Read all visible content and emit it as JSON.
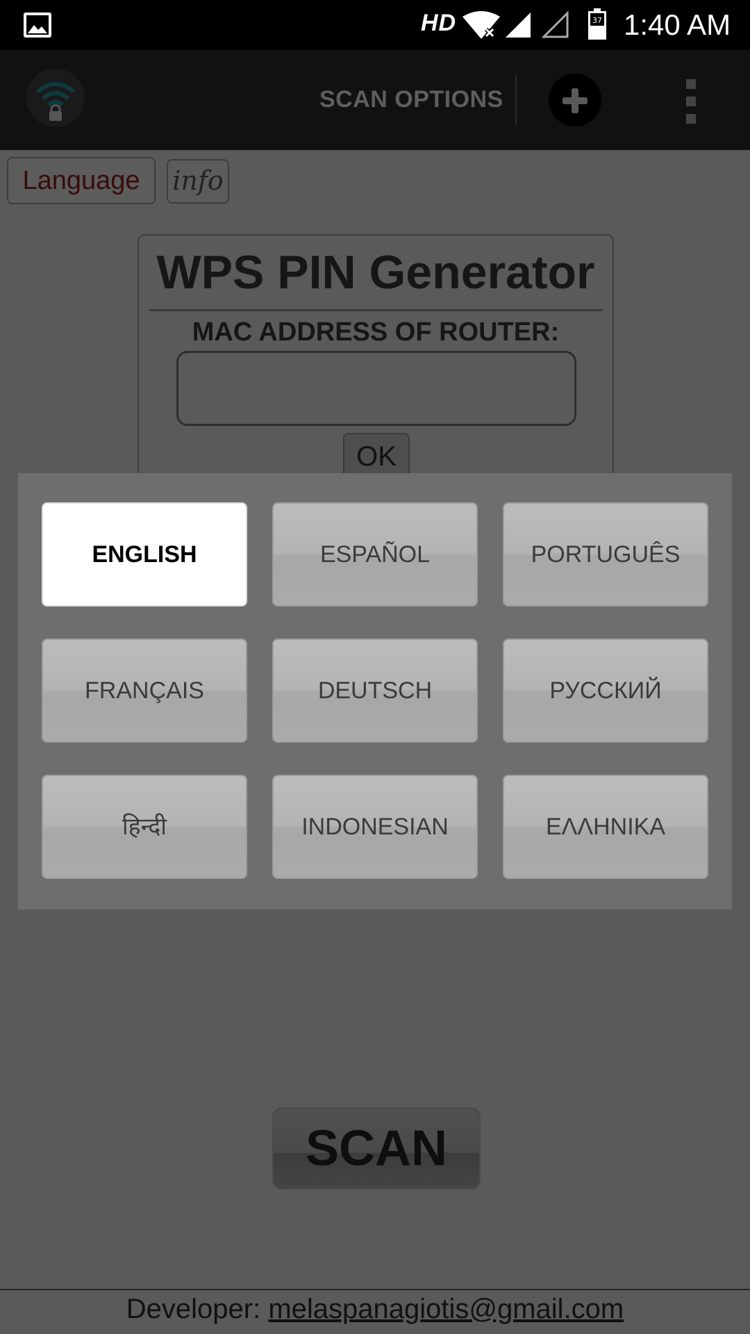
{
  "status_bar": {
    "network": "HD",
    "battery": "37",
    "time": "1:40 AM"
  },
  "action_bar": {
    "scan_options_label": "SCAN OPTIONS"
  },
  "top_buttons": {
    "language_label": "Language",
    "info_label": "info"
  },
  "card": {
    "title": "WPS PIN Generator",
    "mac_label": "MAC ADDRESS OF ROUTER:",
    "mac_value": "",
    "ok_label": "OK"
  },
  "language_dialog": {
    "selected": "ENGLISH",
    "options": [
      "ENGLISH",
      "ESPAÑOL",
      "PORTUGUÊS",
      "FRANÇAIS",
      "DEUTSCH",
      "РУССКИЙ",
      "हिन्दी",
      "INDONESIAN",
      "ΕΛΛΗΝΙΚΑ"
    ]
  },
  "scan_label": "SCAN",
  "footer": {
    "prefix": "Developer:",
    "email": "melaspanagiotis@gmail.com"
  }
}
